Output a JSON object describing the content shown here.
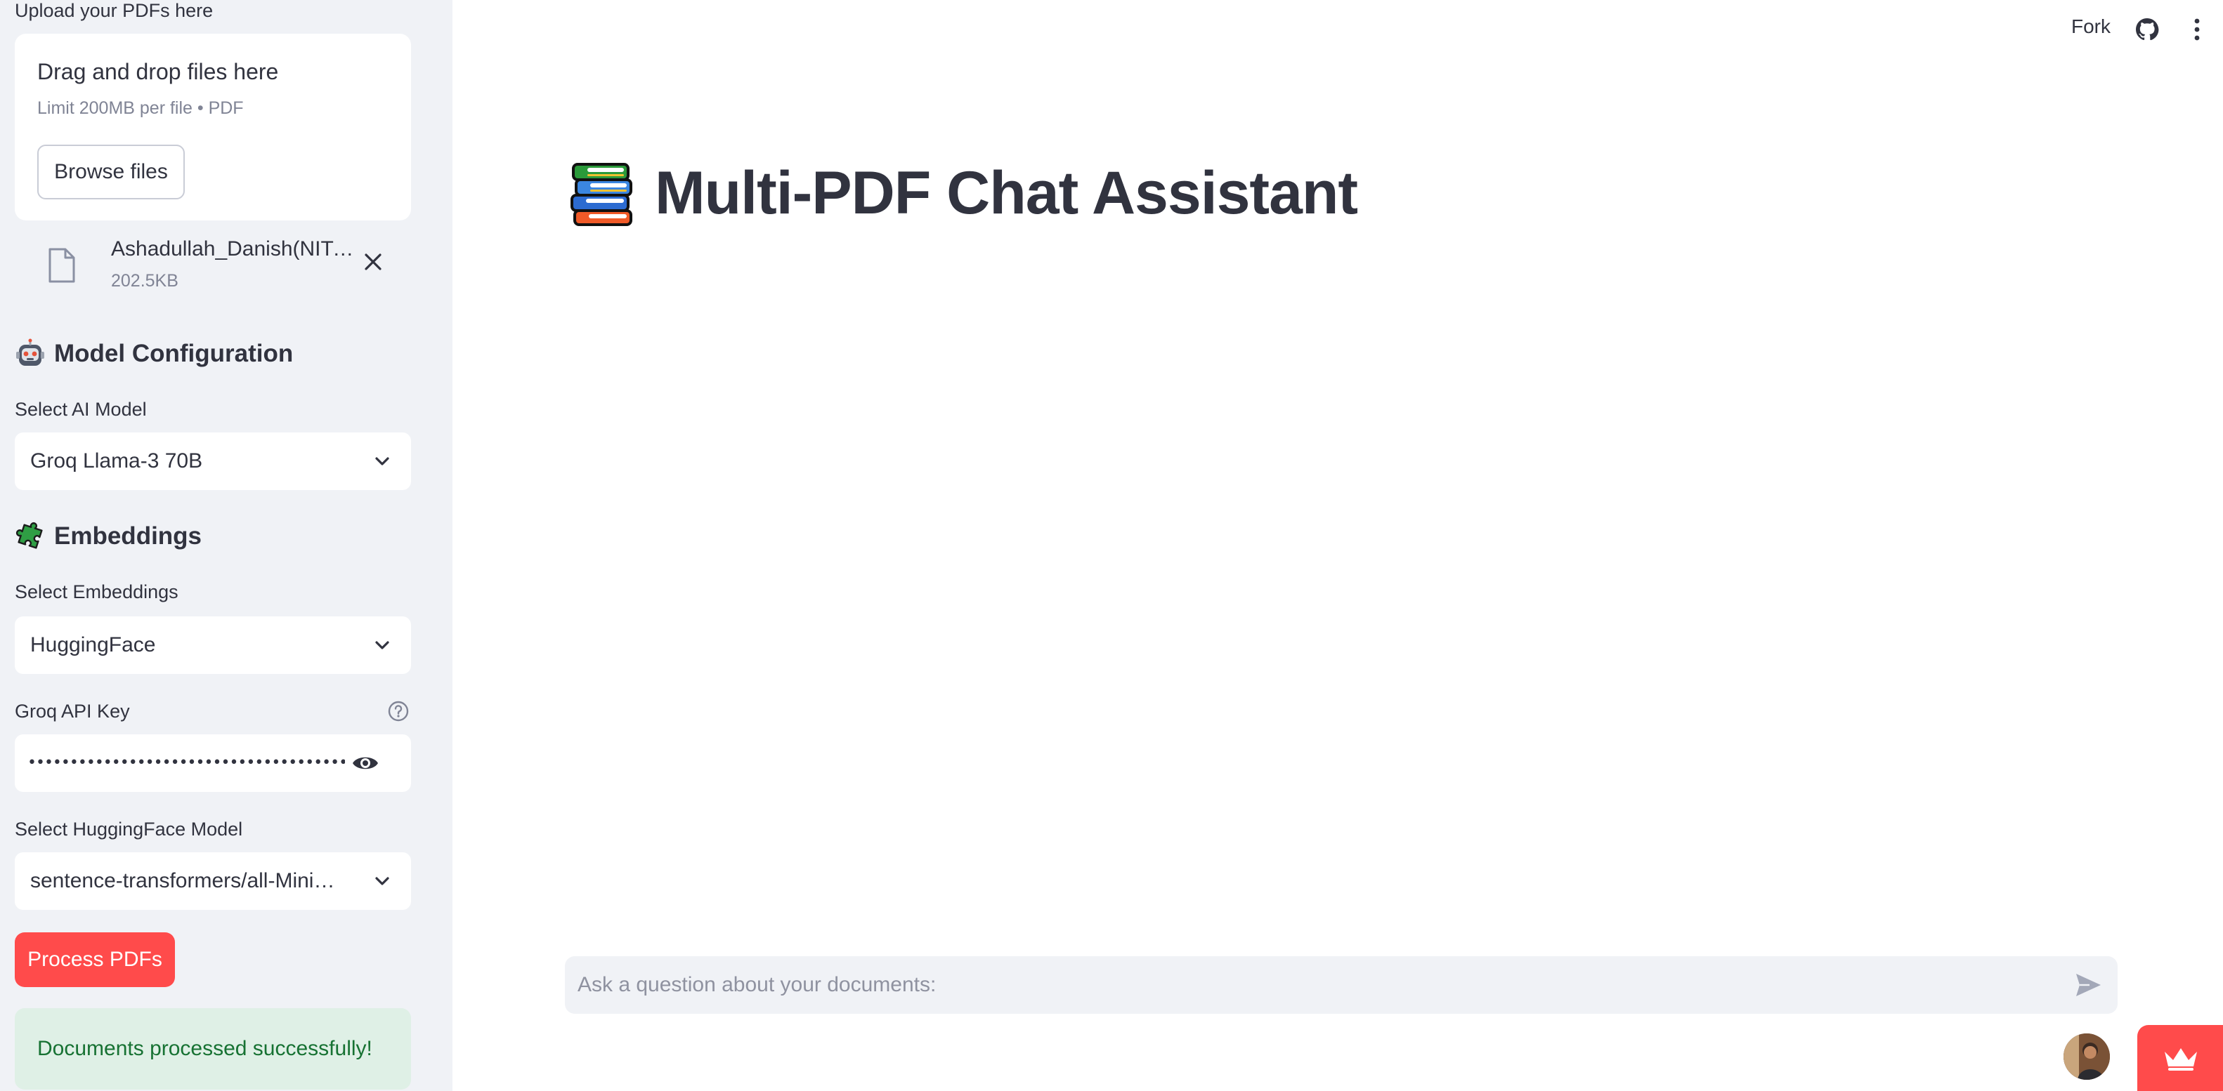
{
  "sidebar": {
    "upload_label": "Upload your PDFs here",
    "dropzone": {
      "title": "Drag and drop files here",
      "limit": "Limit 200MB per file • PDF",
      "browse_label": "Browse files"
    },
    "file": {
      "name": "Ashadullah_Danish(NIT-…",
      "size": "202.5KB",
      "icon": "file-icon"
    },
    "model_section": {
      "title": "Model Configuration",
      "icon": "robot-face-icon",
      "select_label": "Select AI Model",
      "selected": "Groq Llama-3 70B"
    },
    "embeddings_section": {
      "title": "Embeddings",
      "icon": "puzzle-piece-icon",
      "select_label": "Select Embeddings",
      "selected": "HuggingFace"
    },
    "api_key": {
      "label": "Groq API Key",
      "masked_value": "•••••••••••••••••••••••••••••••••••••••••••••••••"
    },
    "hf_model": {
      "label": "Select HuggingFace Model",
      "selected": "sentence-transformers/all-Mini…"
    },
    "process_button": "Process PDFs",
    "success_message": "Documents processed successfully!"
  },
  "header": {
    "fork_label": "Fork"
  },
  "main": {
    "title": "Multi-PDF Chat Assistant",
    "title_icon": "books-icon",
    "chat_placeholder": "Ask a question about your documents:"
  },
  "colors": {
    "sidebar_bg": "#f0f2f6",
    "accent": "#ff4b4b",
    "text": "#31333f",
    "success_bg": "#dff0e6",
    "success_text": "#177233"
  }
}
